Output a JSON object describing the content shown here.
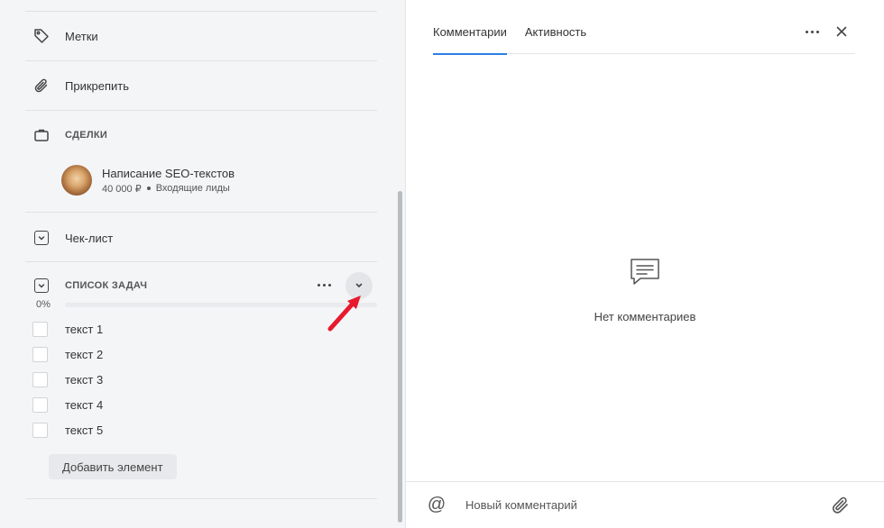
{
  "left_panel": {
    "labels_row": {
      "label": "Метки",
      "icon": "tag-icon"
    },
    "attach_row": {
      "label": "Прикрепить",
      "icon": "paperclip-icon"
    },
    "deals_section": {
      "title": "СДЕЛКИ",
      "icon": "briefcase-icon",
      "deal": {
        "title": "Написание SEO-текстов",
        "amount": "40 000 ₽",
        "stage": "Входящие лиды"
      }
    },
    "checklist_row": {
      "label": "Чек-лист",
      "icon": "checkbox-icon"
    },
    "task_list": {
      "title": "СПИСОК ЗАДАЧ",
      "progress_label": "0%",
      "progress_fraction": 0,
      "items": [
        {
          "label": "текст 1",
          "checked": false
        },
        {
          "label": "текст 2",
          "checked": false
        },
        {
          "label": "текст 3",
          "checked": false
        },
        {
          "label": "текст 4",
          "checked": false
        },
        {
          "label": "текст 5",
          "checked": false
        }
      ],
      "add_button": "Добавить элемент"
    }
  },
  "right_panel": {
    "tabs": [
      {
        "label": "Комментарии",
        "active": true
      },
      {
        "label": "Активность",
        "active": false
      }
    ],
    "empty_state": "Нет комментариев",
    "composer": {
      "placeholder": "Новый комментарий",
      "mention_symbol": "@"
    }
  },
  "colors": {
    "accent": "#2f7fe3",
    "annotation_arrow": "#e8192c",
    "left_background": "#f4f5f7"
  }
}
